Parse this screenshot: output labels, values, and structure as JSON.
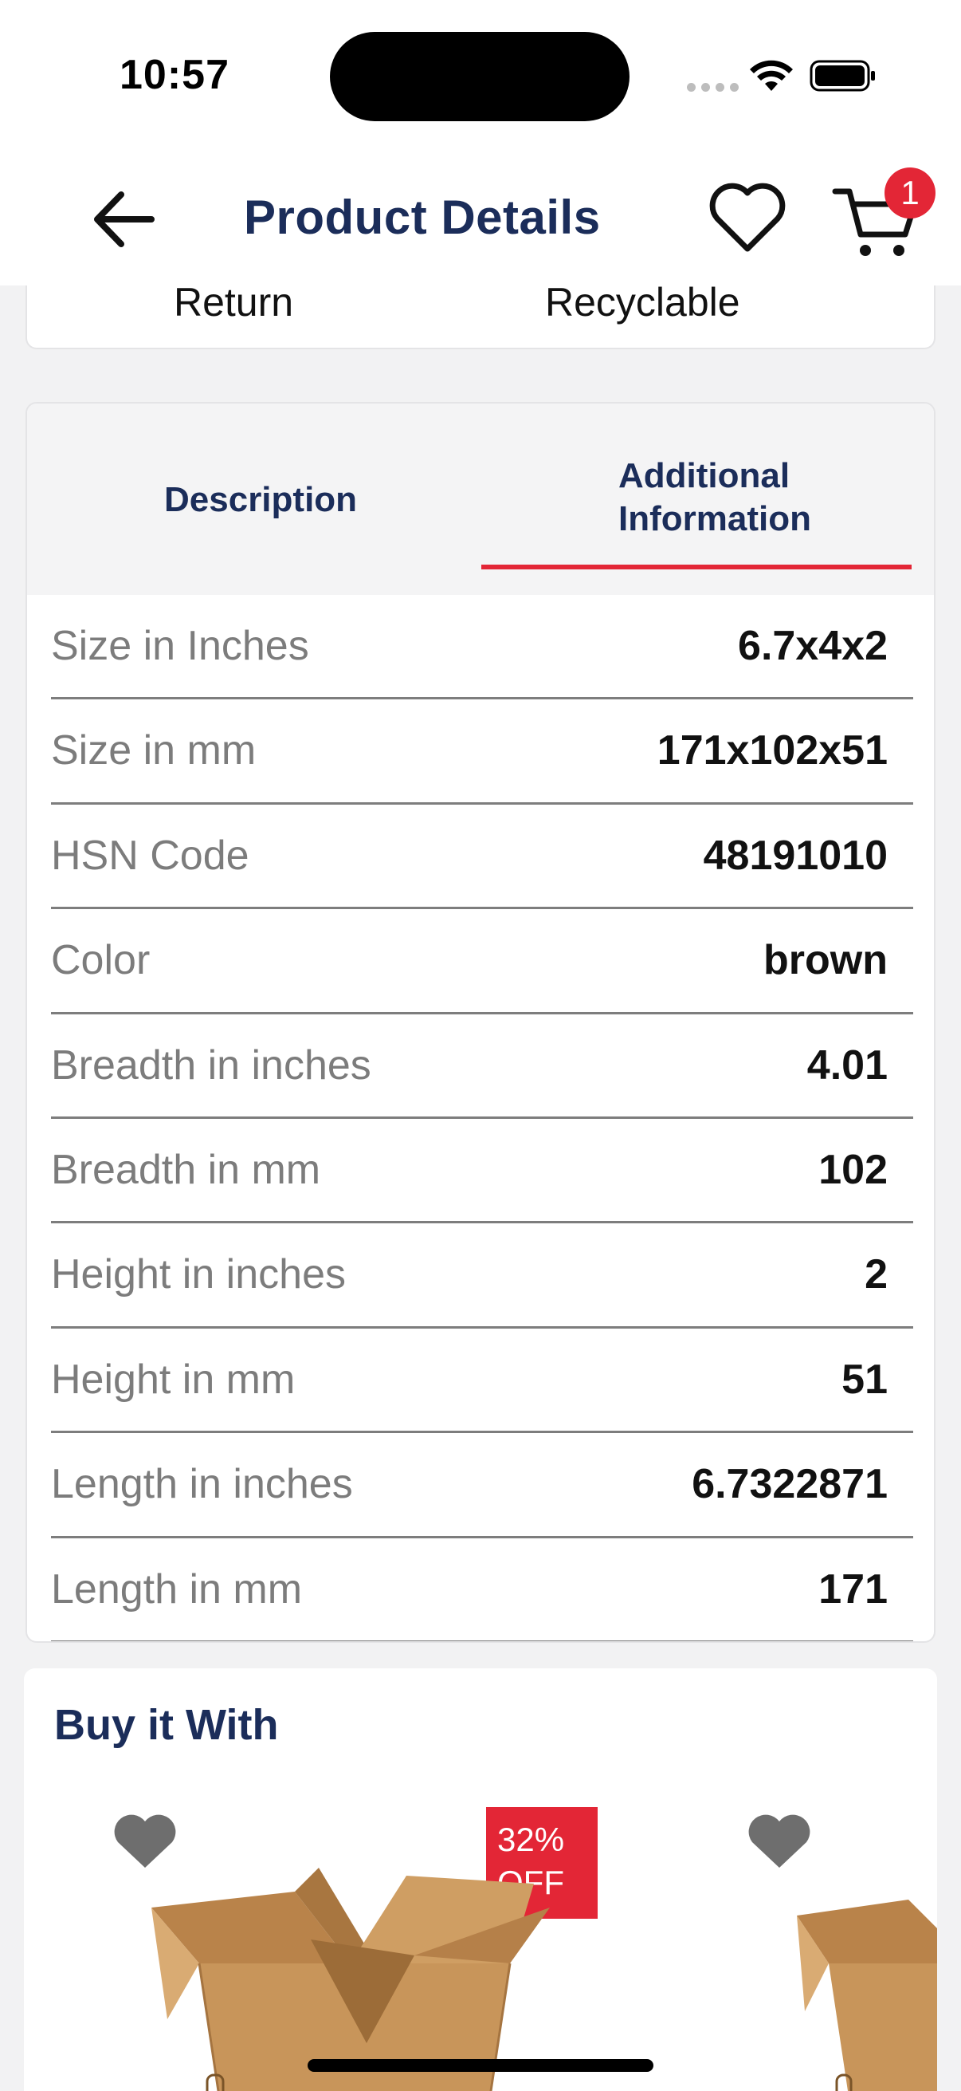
{
  "status_bar": {
    "time": "10:57"
  },
  "header": {
    "title": "Product Details",
    "cart_count": "1",
    "icons": [
      "back-arrow-icon",
      "heart-outline-icon",
      "cart-icon"
    ]
  },
  "policies": {
    "return_label": "Return",
    "recyclable_label": "Recyclable"
  },
  "tabs": {
    "description_label": "Description",
    "additional_label": "Additional Information",
    "active": "Additional Information"
  },
  "specs": [
    {
      "label": "Size in Inches",
      "value": "6.7x4x2"
    },
    {
      "label": "Size in mm",
      "value": "171x102x51"
    },
    {
      "label": "HSN Code",
      "value": "48191010"
    },
    {
      "label": "Color",
      "value": "brown"
    },
    {
      "label": "Breadth in inches",
      "value": "4.01"
    },
    {
      "label": "Breadth in mm",
      "value": "102"
    },
    {
      "label": "Height in inches",
      "value": "2"
    },
    {
      "label": "Height in mm",
      "value": "51"
    },
    {
      "label": "Length in inches",
      "value": "6.7322871"
    },
    {
      "label": "Length in mm",
      "value": "171"
    }
  ],
  "buy_it_with": {
    "title": "Buy it With",
    "products": [
      {
        "discount_pct": "32%",
        "discount_suffix": "OFF"
      }
    ]
  },
  "colors": {
    "accent_red": "#e32636",
    "navy": "#1b2d5a",
    "muted_label": "#7c7c7c"
  }
}
